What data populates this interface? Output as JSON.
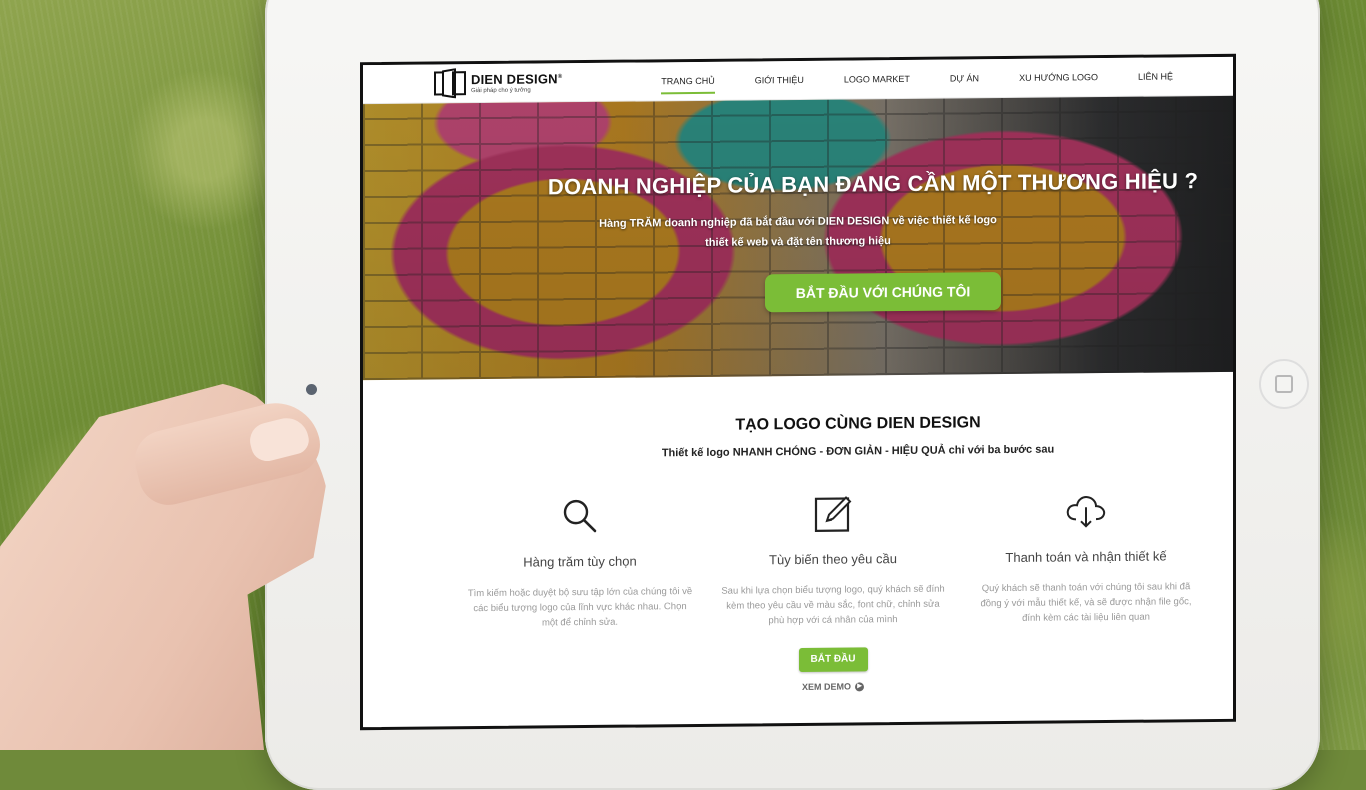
{
  "brand": {
    "name": "DIEN DESIGN",
    "registered": "®",
    "tagline": "Giải pháp cho ý tưởng"
  },
  "nav": {
    "items": [
      {
        "label": "TRANG CHỦ",
        "active": true
      },
      {
        "label": "GIỚI THIỆU",
        "active": false
      },
      {
        "label": "LOGO MARKET",
        "active": false
      },
      {
        "label": "DỰ ÁN",
        "active": false
      },
      {
        "label": "XU HƯỚNG LOGO",
        "active": false
      },
      {
        "label": "LIÊN HỆ",
        "active": false
      }
    ]
  },
  "hero": {
    "title": "DOANH NGHIỆP CỦA BẠN ĐANG CẦN MỘT THƯƠNG HIỆU ?",
    "subtitle_line1": "Hàng TRĂM doanh nghiệp đã bắt đầu với DIEN DESIGN về việc thiết kế logo",
    "subtitle_line2": "thiết kế web và đặt tên thương hiệu",
    "cta_label": "BẮT ĐẦU VỚI CHÚNG TÔI"
  },
  "section": {
    "title": "TẠO LOGO CÙNG DIEN DESIGN",
    "subtitle": "Thiết kế logo NHANH CHÓNG - ĐƠN GIẢN - HIỆU QUẢ chỉ với ba bước sau"
  },
  "features": [
    {
      "icon": "search-icon",
      "title": "Hàng trăm tùy chọn",
      "description": "Tìm kiếm hoặc duyệt bộ sưu tập lớn của chúng tôi về các biểu tượng logo của lĩnh vực khác nhau. Chọn một để chỉnh sửa."
    },
    {
      "icon": "edit-icon",
      "title": "Tùy biến theo yêu cầu",
      "description": "Sau khi lựa chọn biểu tượng logo, quý khách sẽ đính kèm theo yêu cầu về màu sắc, font chữ, chỉnh sửa phù hợp với cá nhân của mình"
    },
    {
      "icon": "cloud-download-icon",
      "title": "Thanh toán và nhận thiết kế",
      "description": "Quý khách sẽ thanh toán với chúng tôi sau khi đã đồng ý với mẫu thiết kế, và sẽ được nhận file gốc, đính kèm các tài liệu liên quan"
    }
  ],
  "cta": {
    "start_label": "BẮT ĐẦU",
    "demo_label": "XEM DEMO"
  },
  "colors": {
    "accent": "#7bbd37",
    "text_dark": "#111111",
    "text_muted": "#9a9a9a"
  }
}
